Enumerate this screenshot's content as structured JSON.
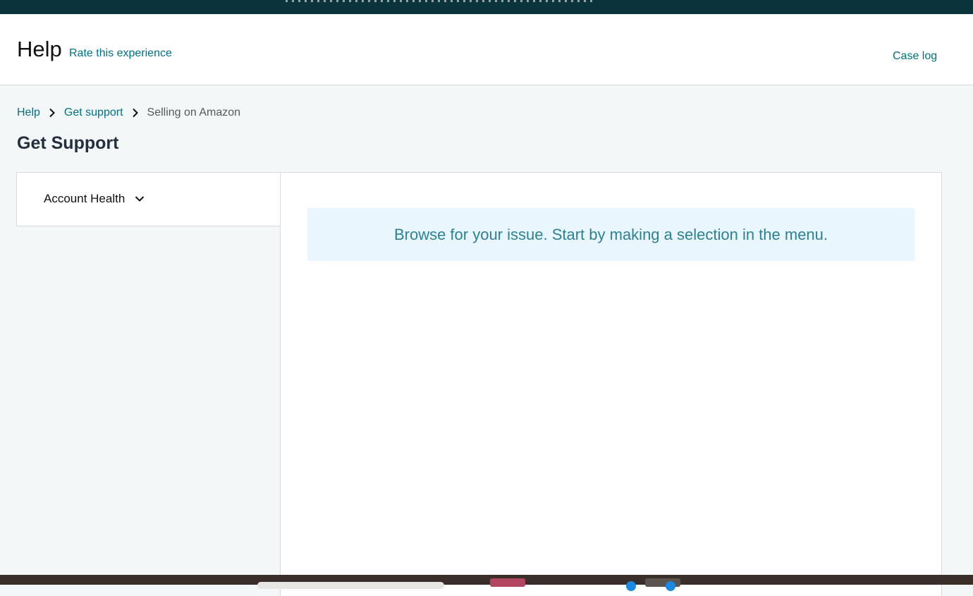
{
  "header": {
    "title": "Help",
    "rate_link": "Rate this experience",
    "case_log": "Case log"
  },
  "breadcrumb": {
    "items": [
      "Help",
      "Get support",
      "Selling on Amazon"
    ]
  },
  "page": {
    "title": "Get Support"
  },
  "menu": {
    "items": [
      {
        "label": "Account Health",
        "icon": "chevron-down-icon"
      }
    ]
  },
  "content": {
    "message": "Browse for your issue. Start by making a selection in the menu."
  },
  "colors": {
    "top_bar": "#0b333c",
    "link": "#007185",
    "info_background": "#eaf6fd",
    "info_text": "#2b8296",
    "page_background": "#f3f7f8"
  }
}
